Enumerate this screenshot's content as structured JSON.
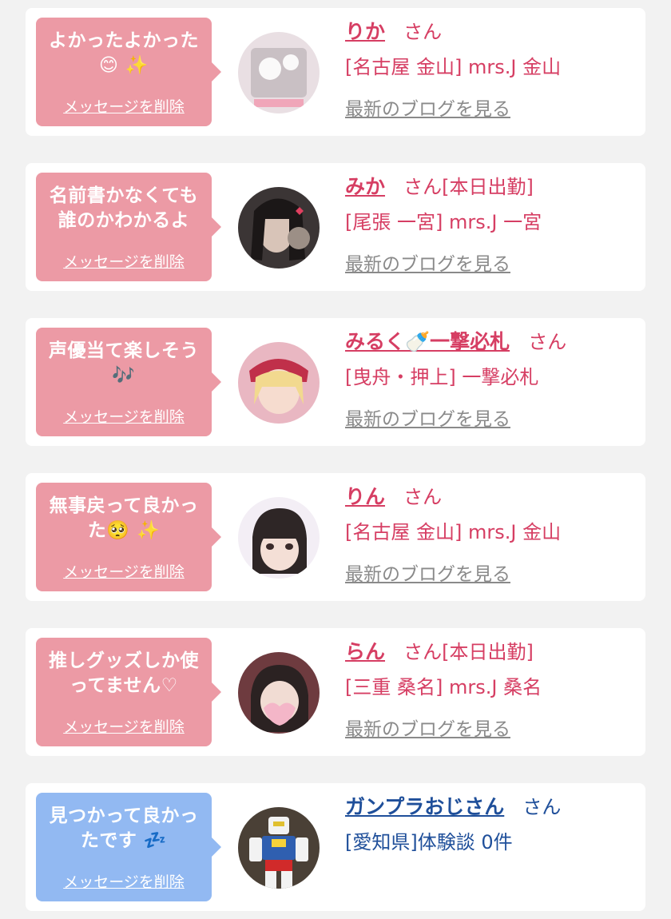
{
  "delete_label": "メッセージを削除",
  "blog_label": "最新のブログを見る",
  "items": [
    {
      "message_lines": [
        "よかったよかった",
        "😊 ✨"
      ],
      "name": "りか",
      "suffix": "さん",
      "shop": "[名古屋 金山] mrs.J 金山",
      "theme": "pink",
      "avatar_icon": "cast-photo-icon"
    },
    {
      "message_lines": [
        "名前書かなくても",
        "誰のかわかるよ"
      ],
      "name": "みか",
      "suffix": "さん[本日出勤]",
      "shop": "[尾張 一宮] mrs.J 一宮",
      "theme": "pink",
      "avatar_icon": "cast-photo-icon"
    },
    {
      "message_lines": [
        "声優当て楽しそう",
        "🎶"
      ],
      "name": "みるく🍼一撃必札",
      "suffix": "さん",
      "shop": "[曳舟・押上] 一撃必札",
      "theme": "pink",
      "avatar_icon": "cast-photo-icon"
    },
    {
      "message_lines": [
        "無事戻って良かっ",
        "た🥺 ✨"
      ],
      "name": "りん",
      "suffix": "さん",
      "shop": "[名古屋 金山] mrs.J 金山",
      "theme": "pink",
      "avatar_icon": "cast-photo-icon"
    },
    {
      "message_lines": [
        "推しグッズしか使",
        "ってません♡"
      ],
      "name": "らん",
      "suffix": "さん[本日出勤]",
      "shop": "[三重 桑名] mrs.J 桑名",
      "theme": "pink",
      "avatar_icon": "cast-photo-icon"
    },
    {
      "message_lines": [
        "見つかって良かっ",
        "たです 💤"
      ],
      "name": "ガンプラおじさん",
      "suffix": "さん",
      "shop": "[愛知県]体験談 0件",
      "theme": "blue",
      "avatar_icon": "robot-figure-photo-icon"
    }
  ],
  "colors": {
    "pink_bubble": "#ec9aa5",
    "blue_bubble": "#92b9f2",
    "pink_text": "#d63e63",
    "navy_text": "#1f4f9a",
    "link_gray": "#8a8a8a",
    "background": "#f2f2f2"
  }
}
